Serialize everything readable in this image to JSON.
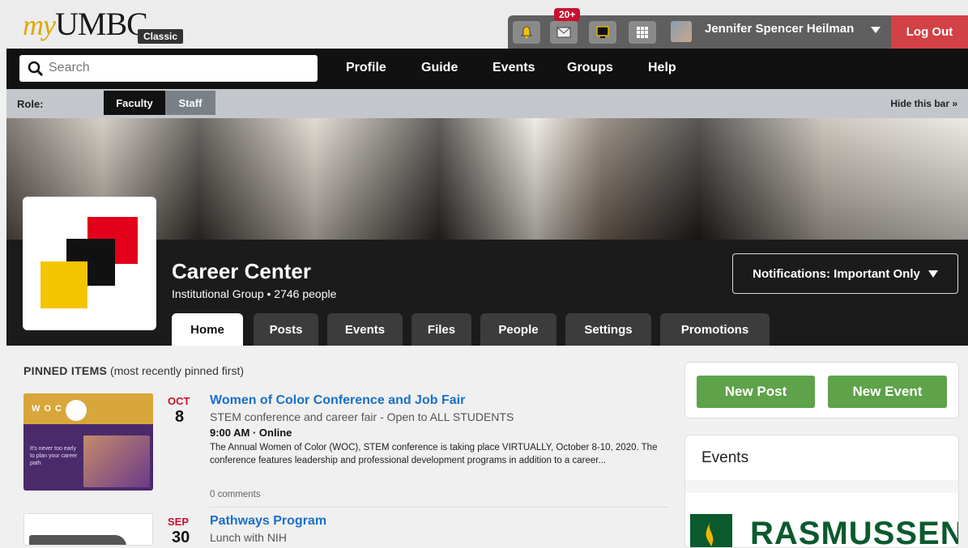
{
  "header": {
    "logo_prefix": "my",
    "logo_main": "UMBC",
    "logo_badge": "Classic",
    "notification_count": "20+",
    "user_name": "Jennifer Spencer Heilman",
    "logout_label": "Log Out"
  },
  "nav": {
    "search_placeholder": "Search",
    "links": [
      "Profile",
      "Guide",
      "Events",
      "Groups",
      "Help"
    ]
  },
  "rolebar": {
    "label": "Role:",
    "roles": [
      "Faculty",
      "Staff"
    ],
    "hide_label": "Hide this bar »"
  },
  "group": {
    "name": "Career Center",
    "meta": "Institutional Group • 2746 people",
    "notifications_label": "Notifications: Important Only",
    "tabs": [
      "Home",
      "Posts",
      "Events",
      "Files",
      "People",
      "Settings",
      "Promotions"
    ],
    "active_tab": "Home"
  },
  "pinned": {
    "heading": "PINNED ITEMS",
    "heading_note": " (most recently pinned first)",
    "items": [
      {
        "month": "OCT",
        "day": "8",
        "title": "Women of Color Conference and Job Fair",
        "subtitle": "STEM conference and career fair - Open to ALL STUDENTS",
        "time": "9:00 AM · Online",
        "description": "The Annual Women of Color (WOC), STEM conference is taking place VIRTUALLY, October 8-10, 2020. The conference features leadership and professional development programs in addition to a career...",
        "comments": "0 comments",
        "thumb_text": "WOC",
        "thumb_caption": "It's never too early to plan your career path"
      },
      {
        "month": "SEP",
        "day": "30",
        "title": "Pathways Program",
        "subtitle": "Lunch with NIH"
      }
    ]
  },
  "sidebar": {
    "new_post_label": "New Post",
    "new_event_label": "New Event",
    "events_title": "Events",
    "ad_text": "RASMUSSEN"
  },
  "colors": {
    "accent_red": "#d24146",
    "link_blue": "#1a6fc9",
    "button_green": "#5ea24a",
    "date_red": "#c8102e"
  },
  "icons": [
    "bell-icon",
    "mail-icon",
    "monitor-icon",
    "apps-grid-icon",
    "search-icon",
    "chevron-down-icon"
  ]
}
